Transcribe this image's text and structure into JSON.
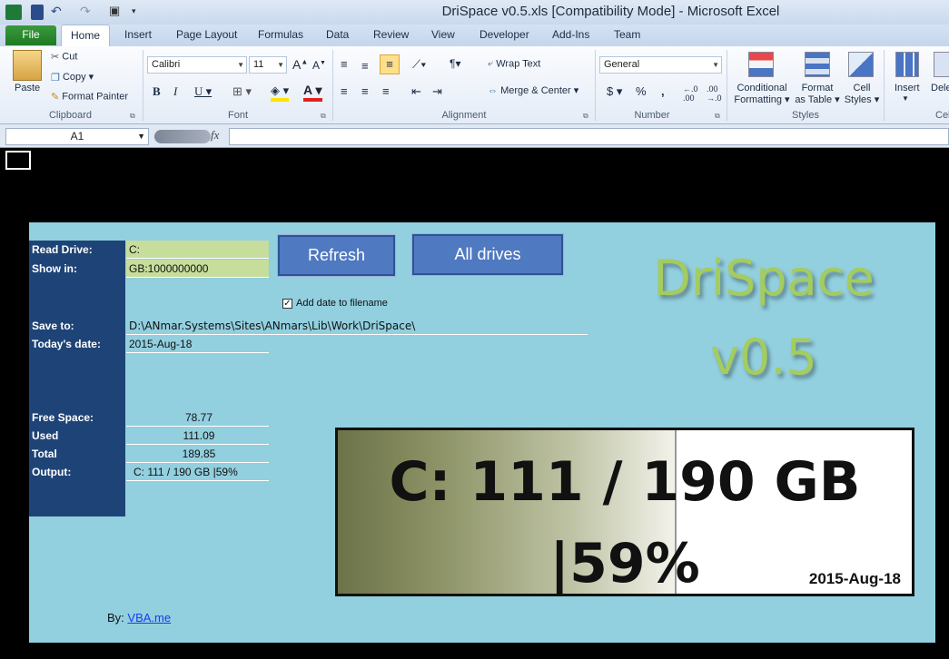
{
  "window": {
    "title": "DriSpace v0.5.xls  [Compatibility Mode]  -  Microsoft Excel"
  },
  "tabs": {
    "file": "File",
    "home": "Home",
    "insert": "Insert",
    "page_layout": "Page Layout",
    "formulas": "Formulas",
    "data": "Data",
    "review": "Review",
    "view": "View",
    "developer": "Developer",
    "addins": "Add-Ins",
    "team": "Team"
  },
  "ribbon": {
    "clipboard": {
      "paste": "Paste",
      "cut": "Cut",
      "copy": "Copy",
      "format_painter": "Format Painter",
      "label": "Clipboard"
    },
    "font": {
      "name": "Calibri",
      "size": "11",
      "label": "Font"
    },
    "alignment": {
      "wrap": "Wrap Text",
      "merge": "Merge & Center",
      "label": "Alignment"
    },
    "number": {
      "format": "General",
      "label": "Number"
    },
    "styles": {
      "cond1": "Conditional",
      "cond2": "Formatting",
      "fmt1": "Format",
      "fmt2": "as Table",
      "cell1": "Cell",
      "cell2": "Styles",
      "label": "Styles"
    },
    "cells": {
      "insert": "Insert",
      "delete": "Dele",
      "label": "Cel"
    }
  },
  "formula_bar": {
    "name_box": "A1",
    "fx": "fx"
  },
  "drispace": {
    "labels": {
      "read_drive": "Read Drive:",
      "show_in": "Show in:",
      "save_to": "Save to:",
      "today": "Today's date:",
      "free": "Free Space:",
      "used": "Used",
      "total": "Total",
      "output": "Output:"
    },
    "values": {
      "read_drive": "C:",
      "show_in": "GB:1000000000",
      "save_to": "D:\\ANmar.Systems\\Sites\\ANmars\\Lib\\Work\\DriSpace\\",
      "today": "2015-Aug-18",
      "free": "78.77",
      "used": "111.09",
      "total": "189.85",
      "output": "C: 111 / 190 GB |59%"
    },
    "buttons": {
      "refresh": "Refresh",
      "all_drives": "All drives"
    },
    "checkbox": {
      "label": "Add date to filename",
      "checked": true,
      "mark": "✓"
    },
    "logo": {
      "line1": "DriSpace",
      "line2": "v0.5"
    },
    "gauge": {
      "line1": "C: 111 / 190 GB",
      "line2": "|59%",
      "date": "2015-Aug-18",
      "fill_percent": 59
    },
    "credit": {
      "by": "By:",
      "link": "VBA.me"
    }
  },
  "colors": {
    "panel": "#92cfdf",
    "label_bg": "#1e4477",
    "input_bg": "#c6dd9c",
    "button": "#4f79c0",
    "logo": "#a4cc5e"
  }
}
